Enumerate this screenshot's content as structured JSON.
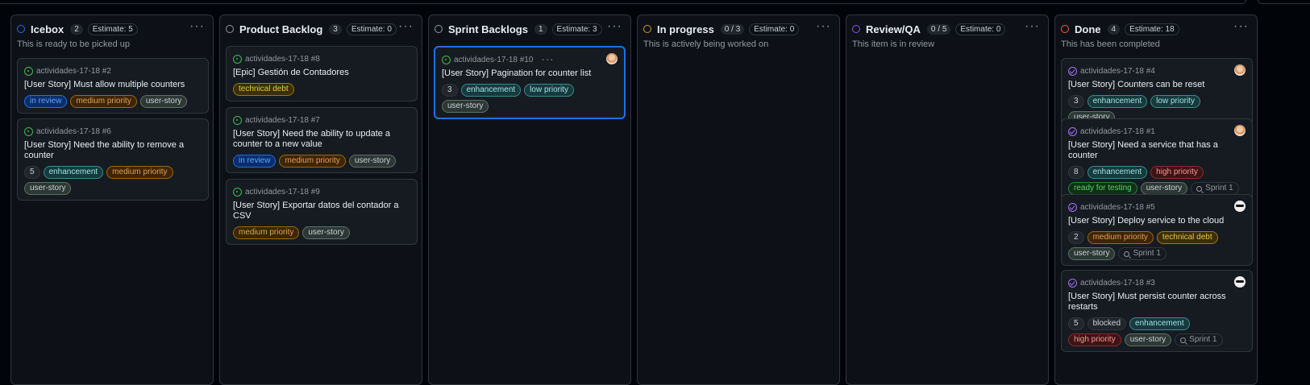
{
  "colors": {
    "background": "#010409",
    "column_bg": "#0d1117",
    "card_bg": "#161b22",
    "border": "#30363d",
    "selected_border": "#1f6feb"
  },
  "columns": [
    {
      "title": "Icebox",
      "count": "2",
      "estimate": "Estimate: 5",
      "description": "This is ready to be picked up",
      "status_color": "#1f6feb",
      "cards": [
        {
          "ref": "actividades-17-18 #2",
          "title": "[User Story] Must allow multiple counters",
          "state": "open",
          "labels": [
            {
              "text": "in review",
              "kind": "in-review"
            },
            {
              "text": "medium priority",
              "kind": "medium"
            },
            {
              "text": "user-story",
              "kind": "user-story"
            }
          ]
        },
        {
          "ref": "actividades-17-18 #6",
          "title": "[User Story] Need the ability to remove a counter",
          "state": "open",
          "labels": [
            {
              "text": "5",
              "kind": "num"
            },
            {
              "text": "enhancement",
              "kind": "enhancement"
            },
            {
              "text": "medium priority",
              "kind": "medium"
            },
            {
              "text": "user-story",
              "kind": "user-story"
            }
          ]
        }
      ]
    },
    {
      "title": "Product Backlog",
      "count": "3",
      "estimate": "Estimate: 0",
      "description": "",
      "status_color": "#9198a1",
      "cards": [
        {
          "ref": "actividades-17-18 #8",
          "title": "[Epic] Gestión de Contadores",
          "state": "open",
          "labels": [
            {
              "text": "technical debt",
              "kind": "tech-debt"
            }
          ]
        },
        {
          "ref": "actividades-17-18 #7",
          "title": "[User Story] Need the ability to update a counter to a new value",
          "state": "open",
          "labels": [
            {
              "text": "in review",
              "kind": "in-review"
            },
            {
              "text": "medium priority",
              "kind": "medium"
            },
            {
              "text": "user-story",
              "kind": "user-story"
            }
          ]
        },
        {
          "ref": "actividades-17-18 #9",
          "title": "[User Story] Exportar datos del contador a CSV",
          "state": "open",
          "labels": [
            {
              "text": "medium priority",
              "kind": "medium"
            },
            {
              "text": "user-story",
              "kind": "user-story"
            }
          ]
        }
      ]
    },
    {
      "title": "Sprint Backlogs",
      "count": "1",
      "estimate": "Estimate: 3",
      "description": "",
      "status_color": "#9198a1",
      "cards": [
        {
          "ref": "actividades-17-18 #10",
          "title": "[User Story] Pagination for counter list",
          "state": "open",
          "more": "···",
          "avatar": "light",
          "labels": [
            {
              "text": "3",
              "kind": "num"
            },
            {
              "text": "enhancement",
              "kind": "enhancement"
            },
            {
              "text": "low priority",
              "kind": "low"
            },
            {
              "text": "user-story",
              "kind": "user-story"
            }
          ]
        }
      ]
    },
    {
      "title": "In progress",
      "count": "0 / 3",
      "estimate": "Estimate: 0",
      "description": "This is actively being worked on",
      "status_color": "#d29922",
      "cards": []
    },
    {
      "title": "Review/QA",
      "count": "0 / 5",
      "estimate": "Estimate: 0",
      "description": "This item is in review",
      "status_color": "#8957e5",
      "cards": []
    },
    {
      "title": "Done",
      "count": "4",
      "estimate": "Estimate: 18",
      "description": "This has been completed",
      "status_color": "#f0603b",
      "cards": [
        {
          "ref": "actividades-17-18 #4",
          "title": "[User Story] Counters can be reset",
          "state": "closed",
          "avatar": "light",
          "labels": [
            {
              "text": "3",
              "kind": "num"
            },
            {
              "text": "enhancement",
              "kind": "enhancement"
            },
            {
              "text": "low priority",
              "kind": "low"
            },
            {
              "text": "user-story",
              "kind": "user-story"
            }
          ]
        },
        {
          "ref": "actividades-17-18 #1",
          "title": "[User Story] Need a service that has a counter",
          "state": "closed",
          "avatar": "light",
          "labels": [
            {
              "text": "8",
              "kind": "num"
            },
            {
              "text": "enhancement",
              "kind": "enhancement"
            },
            {
              "text": "high priority",
              "kind": "high"
            },
            {
              "text": "ready for testing",
              "kind": "ready"
            },
            {
              "text": "user-story",
              "kind": "user-story"
            },
            {
              "text": "Sprint 1",
              "kind": "sprint"
            }
          ]
        },
        {
          "ref": "actividades-17-18 #5",
          "title": "[User Story] Deploy service to the cloud",
          "state": "closed",
          "avatar": "dark",
          "labels": [
            {
              "text": "2",
              "kind": "num"
            },
            {
              "text": "medium priority",
              "kind": "medium"
            },
            {
              "text": "technical debt",
              "kind": "tech-debt"
            },
            {
              "text": "user-story",
              "kind": "user-story"
            },
            {
              "text": "Sprint 1",
              "kind": "sprint"
            }
          ]
        },
        {
          "ref": "actividades-17-18 #3",
          "title": "[User Story] Must persist counter across restarts",
          "state": "closed",
          "avatar": "dark",
          "labels": [
            {
              "text": "5",
              "kind": "num"
            },
            {
              "text": "blocked",
              "kind": "blocked"
            },
            {
              "text": "enhancement",
              "kind": "enhancement"
            },
            {
              "text": "high priority",
              "kind": "high"
            },
            {
              "text": "user-story",
              "kind": "user-story"
            },
            {
              "text": "Sprint 1",
              "kind": "sprint"
            }
          ]
        }
      ]
    }
  ]
}
